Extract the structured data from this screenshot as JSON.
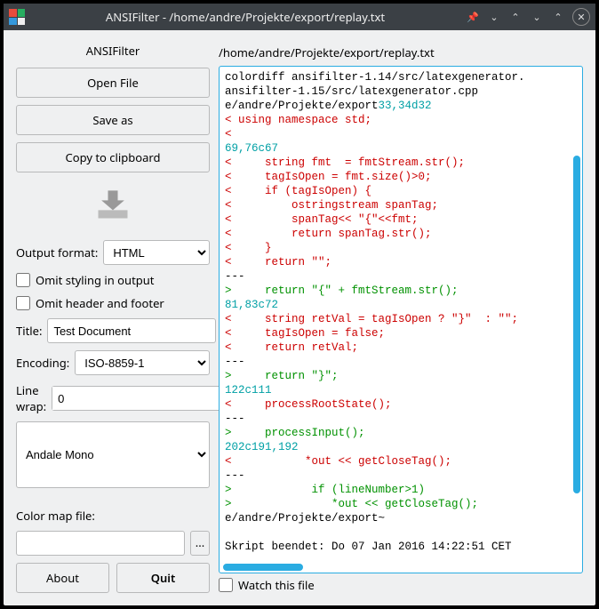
{
  "window": {
    "title": "ANSIFilter - /home/andre/Projekte/export/replay.txt"
  },
  "panel": {
    "title": "ANSIFilter",
    "open": "Open File",
    "save": "Save as",
    "copy": "Copy to clipboard",
    "about": "About",
    "quit": "Quit"
  },
  "output_format": {
    "label": "Output format:",
    "value": "HTML"
  },
  "omit_styling": {
    "label": "Omit styling in output",
    "checked": false
  },
  "omit_header": {
    "label": "Omit header and footer",
    "checked": false
  },
  "title_field": {
    "label": "Title:",
    "value": "Test Document"
  },
  "encoding": {
    "label": "Encoding:",
    "value": "ISO-8859-1"
  },
  "linewrap": {
    "label": "Line wrap:",
    "value": "0"
  },
  "font": {
    "value": "Andale Mono"
  },
  "colormap": {
    "label": "Color map file:",
    "value": ""
  },
  "path": "/home/andre/Projekte/export/replay.txt",
  "watch": {
    "label": "Watch this file",
    "checked": false
  },
  "code": [
    {
      "c": "blk",
      "t": "colordiff ansifilter-1.14/src/latexgenerator."
    },
    {
      "c": "blk",
      "t": "ansifilter-1.15/src/latexgenerator.cpp"
    },
    {
      "c": "blk",
      "t": "e/andre/Projekte/export"
    },
    {
      "c": "cyn",
      "t": "33,34d32"
    },
    {
      "c": "red",
      "t": "< using namespace std;"
    },
    {
      "c": "red",
      "t": "<"
    },
    {
      "c": "cyn",
      "t": "69,76c67"
    },
    {
      "c": "red",
      "t": "<     string fmt  = fmtStream.str();"
    },
    {
      "c": "red",
      "t": "<     tagIsOpen = fmt.size()>0;"
    },
    {
      "c": "red",
      "t": "<     if (tagIsOpen) {"
    },
    {
      "c": "red",
      "t": "<         ostringstream spanTag;"
    },
    {
      "c": "red",
      "t": "<         spanTag<< \"{\"<<fmt;"
    },
    {
      "c": "red",
      "t": "<         return spanTag.str();"
    },
    {
      "c": "red",
      "t": "<     }"
    },
    {
      "c": "red",
      "t": "<     return \"\";"
    },
    {
      "c": "blk",
      "t": "---"
    },
    {
      "c": "grn",
      "t": ">     return \"{\" + fmtStream.str();"
    },
    {
      "c": "cyn",
      "t": "81,83c72"
    },
    {
      "c": "red",
      "t": "<     string retVal = tagIsOpen ? \"}\"  : \"\";"
    },
    {
      "c": "red",
      "t": "<     tagIsOpen = false;"
    },
    {
      "c": "red",
      "t": "<     return retVal;"
    },
    {
      "c": "blk",
      "t": "---"
    },
    {
      "c": "grn",
      "t": ">     return \"}\";"
    },
    {
      "c": "cyn",
      "t": "122c111"
    },
    {
      "c": "red",
      "t": "<     processRootState();"
    },
    {
      "c": "blk",
      "t": "---"
    },
    {
      "c": "grn",
      "t": ">     processInput();"
    },
    {
      "c": "cyn",
      "t": "202c191,192"
    },
    {
      "c": "red",
      "t": "<           *out << getCloseTag();"
    },
    {
      "c": "blk",
      "t": "---"
    },
    {
      "c": "grn",
      "t": ">            if (lineNumber>1)"
    },
    {
      "c": "grn",
      "t": ">               *out << getCloseTag();"
    },
    {
      "c": "blk",
      "t": "e/andre/Projekte/export~"
    },
    {
      "c": "blk",
      "t": ""
    },
    {
      "c": "blk",
      "t": "Skript beendet: Do 07 Jan 2016 14:22:51 CET"
    }
  ]
}
